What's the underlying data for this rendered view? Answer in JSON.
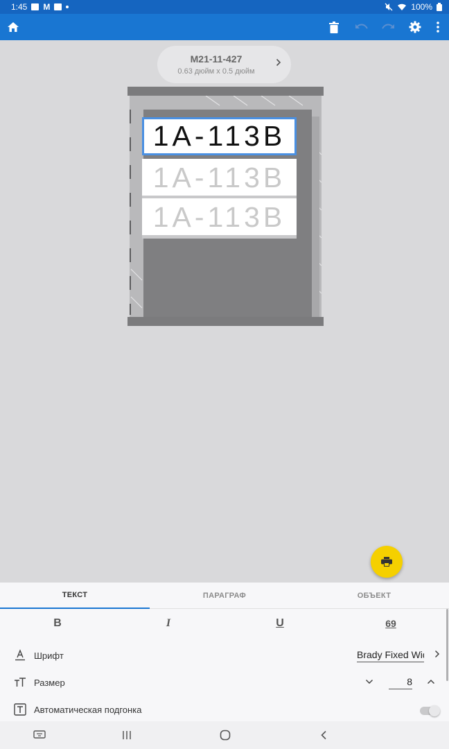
{
  "status_bar": {
    "time": "1:45",
    "battery": "100%"
  },
  "app_bar": {
    "home_icon": "home-icon",
    "delete_icon": "trash-icon",
    "undo_icon": "undo-icon",
    "redo_icon": "redo-icon",
    "settings_icon": "gear-icon",
    "menu_icon": "more-vert-icon"
  },
  "label": {
    "name": "M21-11-427",
    "dimensions": "0.63 дюйм x 0.5 дюйм"
  },
  "sleeves": [
    {
      "text": "1A-113B",
      "selected": true
    },
    {
      "text": "1A-113B",
      "selected": false
    },
    {
      "text": "1A-113B",
      "selected": false
    }
  ],
  "tabs": [
    {
      "label": "ТЕКСТ",
      "active": true
    },
    {
      "label": "ПАРАГРАФ",
      "active": false
    },
    {
      "label": "ОБЪЕКТ",
      "active": false
    }
  ],
  "formatting": {
    "bold": "B",
    "italic": "I",
    "underline": "U",
    "serialize": "69"
  },
  "properties": {
    "font_label": "Шрифт",
    "font_value": "Brady Fixed Width",
    "size_label": "Размер",
    "size_value": "8",
    "autofit_label": "Автоматическая подгонка",
    "autofit_on": false
  },
  "colors": {
    "app_bar": "#1976d2",
    "status_bar": "#1565c0",
    "fab": "#f5d000",
    "selection": "#4a90e2"
  }
}
